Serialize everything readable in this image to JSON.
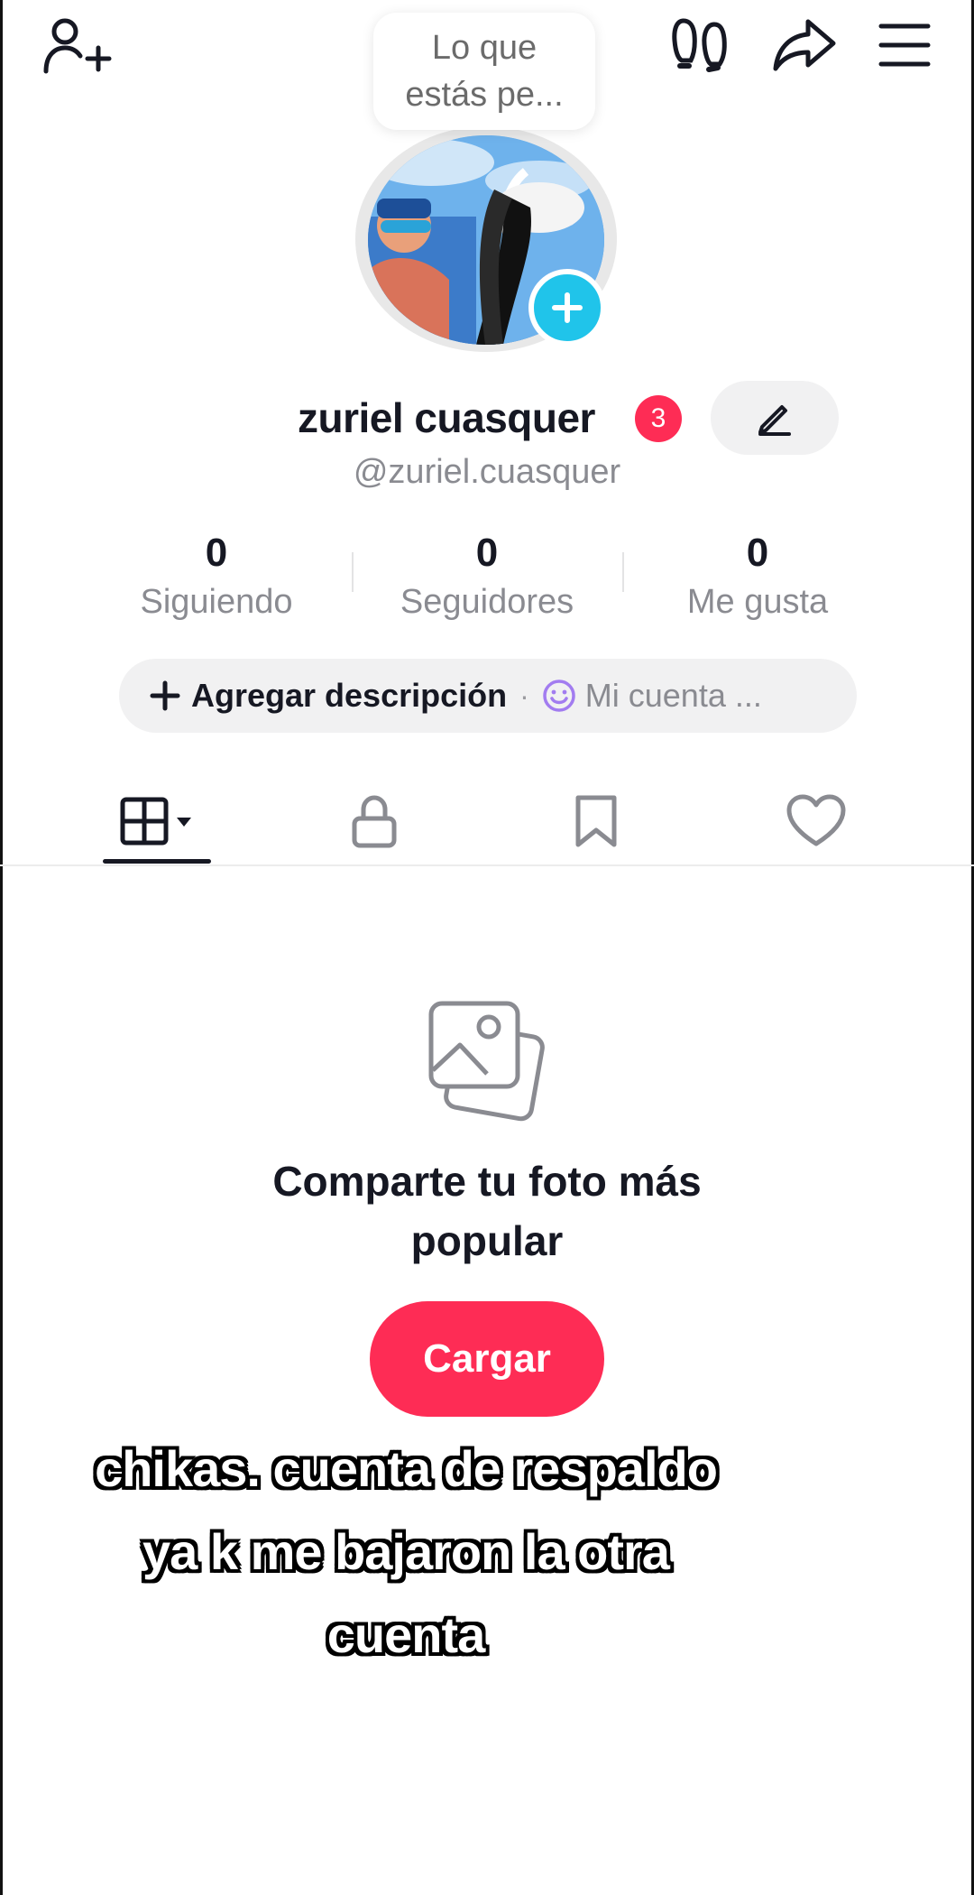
{
  "header": {
    "note_bubble": "Lo que\nestás pe...",
    "icons": [
      "add-friend-icon",
      "footprints-icon",
      "share-icon",
      "menu-icon"
    ]
  },
  "profile": {
    "display_name": "zuriel cuasquer",
    "notification_count": "3",
    "username": "@zuriel.cuasquer",
    "accent_color": "#fe2c55",
    "avatar_plus_color": "#20c4ea"
  },
  "stats": [
    {
      "value": "0",
      "label": "Siguiendo"
    },
    {
      "value": "0",
      "label": "Seguidores"
    },
    {
      "value": "0",
      "label": "Me gusta"
    }
  ],
  "bio_bar": {
    "add_description": "Agregar descripción",
    "separator": "·",
    "account_label": "Mi cuenta ..."
  },
  "tabs": [
    {
      "icon": "grid-icon",
      "active": true
    },
    {
      "icon": "lock-icon",
      "active": false
    },
    {
      "icon": "bookmark-icon",
      "active": false
    },
    {
      "icon": "heart-icon",
      "active": false
    }
  ],
  "empty_state": {
    "title": "Comparte tu foto más popular",
    "button": "Cargar"
  },
  "overlay_caption": "chikas. cuenta de respaldo\nya k me bajaron la otra\ncuenta"
}
